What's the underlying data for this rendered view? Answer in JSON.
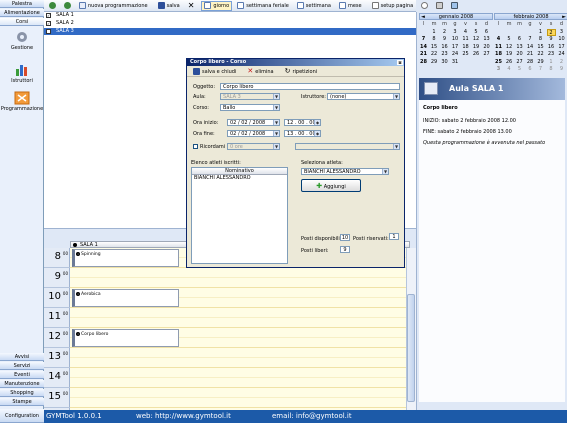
{
  "nav": {
    "top": [
      "Palestra",
      "Alimentazione",
      "Corsi"
    ],
    "items": [
      "Gestione",
      "Istruttori",
      "Programmazione"
    ],
    "bottom": [
      "Avvisi",
      "Servizi",
      "Eventi",
      "Manutenzione",
      "Shopping",
      "Stampe",
      "Configuration"
    ]
  },
  "toolbar": {
    "new_schedule": "nuova programmazione",
    "save": "salva",
    "day": "giorno",
    "workweek": "settimana feriale",
    "week": "settimana",
    "month": "mese",
    "page_setup": "setup pagina"
  },
  "rooms": [
    {
      "name": "SALA 1",
      "checked": true,
      "selected": false
    },
    {
      "name": "SALA 2",
      "checked": true,
      "selected": false
    },
    {
      "name": "SALA 3",
      "checked": true,
      "selected": true
    }
  ],
  "dayview": {
    "column": "SALA 1",
    "hours": [
      "8",
      "9",
      "10",
      "11",
      "12",
      "13",
      "14",
      "15"
    ],
    "minutes": "00",
    "appointments": [
      {
        "title": "Spinning",
        "hour": "8"
      },
      {
        "title": "Aerobica",
        "hour": "10"
      },
      {
        "title": "Corpo libero",
        "hour": "12"
      }
    ]
  },
  "calendar": {
    "weekdays": [
      "l",
      "m",
      "m",
      "g",
      "v",
      "s",
      "d"
    ],
    "months": [
      {
        "title": "gennaio 2008",
        "nav": "◄",
        "weeks": [
          [
            "",
            "1",
            "2",
            "3",
            "4",
            "5",
            "6"
          ],
          [
            "7",
            "8",
            "9",
            "10",
            "11",
            "12",
            "13"
          ],
          [
            "14",
            "15",
            "16",
            "17",
            "18",
            "19",
            "20"
          ],
          [
            "21",
            "22",
            "23",
            "24",
            "25",
            "26",
            "27"
          ],
          [
            "28",
            "29",
            "30",
            "31",
            "",
            "",
            ""
          ]
        ]
      },
      {
        "title": "febbraio 2008",
        "nav": "►",
        "weeks": [
          [
            "",
            "",
            "",
            "",
            "1",
            "2",
            "3"
          ],
          [
            "4",
            "5",
            "6",
            "7",
            "8",
            "9",
            "10"
          ],
          [
            "11",
            "12",
            "13",
            "14",
            "15",
            "16",
            "17"
          ],
          [
            "18",
            "19",
            "20",
            "21",
            "22",
            "23",
            "24"
          ],
          [
            "25",
            "26",
            "27",
            "28",
            "29",
            "1",
            "2"
          ],
          [
            "3",
            "4",
            "5",
            "6",
            "7",
            "8",
            "9"
          ]
        ]
      }
    ]
  },
  "aula": {
    "title": "Aula SALA 1",
    "event": "Corpo libero",
    "start": "INIZIO: sabato 2 febbraio 2008 12.00",
    "end": "FINE: sabato 2 febbraio 2008 13.00",
    "note": "Questa programmazione è avvenuta nel passato"
  },
  "footer": {
    "app": "GYMTool 1.0.0.1",
    "web": "web: http://www.gymtool.it",
    "email": "email: info@gymtool.it"
  },
  "dialog": {
    "title": "Corpo libero - Corso",
    "close": "x",
    "save_close": "salva e chiudi",
    "delete": "elimina",
    "repeat": "ripetizioni",
    "subject_label": "Oggetto:",
    "subject": "Corpo libero",
    "room_label": "Aula:",
    "room": "SALA 3",
    "instructor_label": "Istruttore:",
    "instructor": "(none)",
    "course_label": "Corso:",
    "course": "Ballo",
    "start_label": "Ora inizio:",
    "start_date": "02 / 02 / 2008",
    "start_time": "12 . 00 . 00",
    "end_label": "Ora fine:",
    "end_date": "02 / 02 / 2008",
    "end_time": "13 . 00 . 00",
    "reminder_label": "Ricordami",
    "reminder": "0 ore",
    "enrolled_label": "Elenco atleti iscritti:",
    "enrolled_header": "Nominativo",
    "enrolled": [
      "BIANCHI ALESSANDRO"
    ],
    "select_label": "Seleziona atleta:",
    "select": "BIANCHI ALESSANDRO",
    "add": "Aggiungi",
    "available_label": "Posti disponibili:",
    "available": "10",
    "reserved_label": "Posti riservati:",
    "reserved": "1",
    "free_label": "Posti liberi:",
    "free": "9"
  }
}
